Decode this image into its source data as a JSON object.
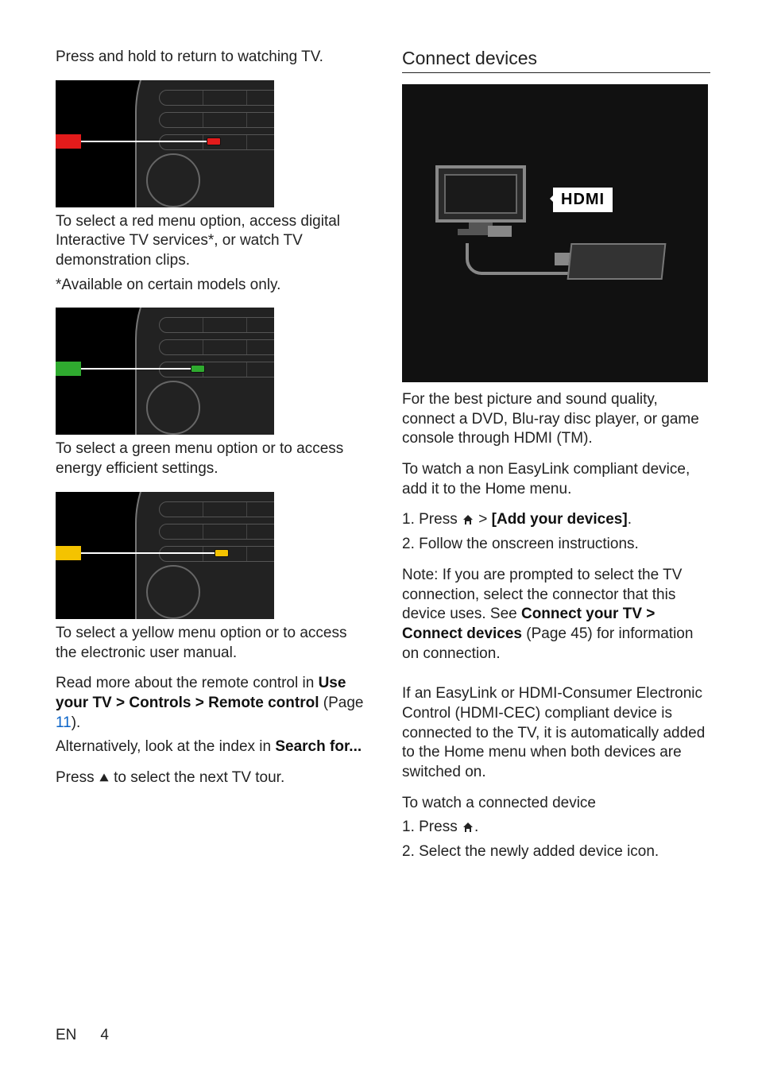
{
  "left": {
    "intro": "Press and hold to return to watching TV.",
    "red_desc": "To select a red menu option, access digital Interactive TV services*, or watch TV demonstration clips.",
    "red_note": "*Available on certain models only.",
    "green_desc": "To select a green menu option or to access energy efficient settings.",
    "yellow_desc": "To select a yellow menu option or to access the electronic user manual.",
    "read_more_pre": "Read more about the remote control in ",
    "read_more_bold": "Use your TV > Controls > Remote control",
    "read_more_page_pre": " (Page ",
    "read_more_page": "11",
    "read_more_page_post": ").",
    "alt_pre": "Alternatively, look at the index in ",
    "alt_bold": "Search for...",
    "press_up": "Press ▲ to select the next TV tour.",
    "press_up_pre": "Press ",
    "press_up_post": " to select the next TV tour."
  },
  "right": {
    "heading": "Connect devices",
    "hdmi_label": "HDMI",
    "p1": "For the best picture and sound quality, connect a DVD, Blu-ray disc player, or game console through HDMI (TM).",
    "p2": "To watch a non EasyLink compliant device, add it to the Home menu.",
    "step1_pre": "1. Press ",
    "step1_mid": " > ",
    "step1_bold": "[Add your devices]",
    "step1_post": ".",
    "step2": "2. Follow the onscreen instructions.",
    "note_pre": "Note: If you are prompted to select the TV connection, select the connector that this device uses. See ",
    "note_bold": "Connect your TV > Connect devices",
    "note_post": " (Page 45) for information on connection.",
    "p3": "If an EasyLink or HDMI-Consumer Electronic Control (HDMI-CEC) compliant device is connected to the TV, it is automatically added to the Home menu when both devices are switched on.",
    "p4": "To watch a connected device",
    "watch_step1_pre": "1. Press ",
    "watch_step1_post": ".",
    "watch_step2": "2. Select the newly added device icon."
  },
  "footer": {
    "lang": "EN",
    "page": "4"
  }
}
